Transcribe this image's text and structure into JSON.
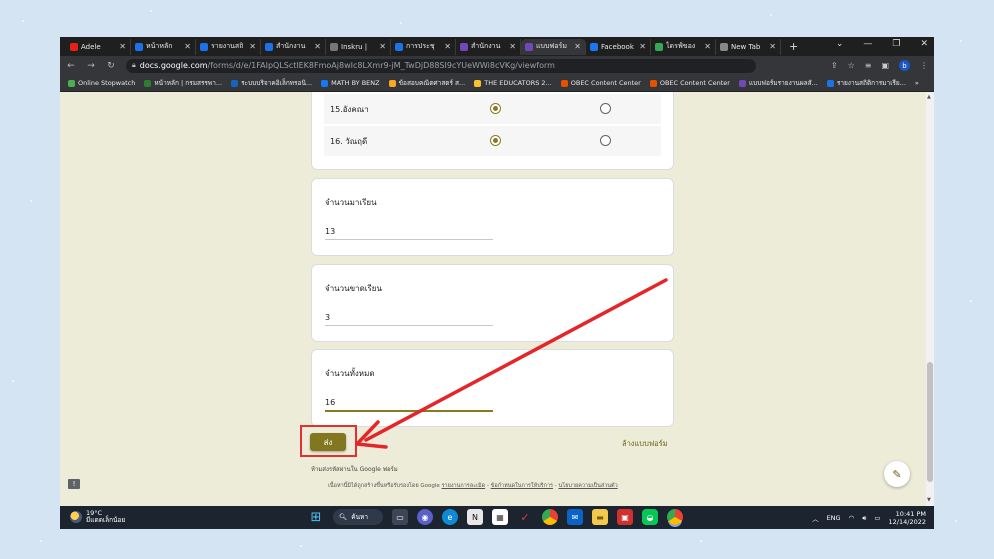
{
  "browser": {
    "tabs": [
      {
        "label": "Adele",
        "color": "#e62117"
      },
      {
        "label": "หน้าหลัก",
        "color": "#1a73e8"
      },
      {
        "label": "รายงานสถิ",
        "color": "#1a73e8"
      },
      {
        "label": "สำนักงาน",
        "color": "#1a73e8"
      },
      {
        "label": "Inskru |",
        "color": "#777777"
      },
      {
        "label": "การประชุ",
        "color": "#1a73e8"
      },
      {
        "label": "สำนักงาน",
        "color": "#7248b9"
      },
      {
        "label": "แบบฟอร์ม",
        "color": "#7248b9"
      },
      {
        "label": "Facebook",
        "color": "#1877f2"
      },
      {
        "label": "ไดรฟ์ของ",
        "color": "#34a853"
      },
      {
        "label": "New Tab",
        "color": "#888888"
      }
    ],
    "new_tab_symbol": "+",
    "url_domain": "docs.google.com",
    "url_path": "/forms/d/e/1FAIpQLSctlEK8FmoAj8wIc8LXmr9-jM_TwDjD88SI9cYUeWWi8cVKg/viewform",
    "profile_initial": "b",
    "bookmarks": [
      {
        "label": "Online Stopwatch",
        "color": "#4caf50"
      },
      {
        "label": "หน้าหลัก | กรมสรรพา...",
        "color": "#2e7d32"
      },
      {
        "label": "ระบบบริจาคอิเล็กทรอนิ...",
        "color": "#1565c0"
      },
      {
        "label": "MATH BY BENZ",
        "color": "#1877f2"
      },
      {
        "label": "ข้อสอบคณิตศาสตร์ ส...",
        "color": "#f9a825"
      },
      {
        "label": "THE EDUCATORS 2...",
        "color": "#fbc02d"
      },
      {
        "label": "OBEC Content Center",
        "color": "#e65100"
      },
      {
        "label": "OBEC Content Center",
        "color": "#e65100"
      },
      {
        "label": "แบบฟอร์มรายงานผลสั...",
        "color": "#7248b9"
      },
      {
        "label": "รายงานสถิติการมาเรีย...",
        "color": "#1a73e8"
      }
    ],
    "bookmarks_more": "»"
  },
  "form": {
    "choices": [
      {
        "label": "15.อังคณา",
        "first_selected": true
      },
      {
        "label": "16. วัณฤดี",
        "first_selected": true
      }
    ],
    "questions": [
      {
        "label": "จำนวนมาเรียน",
        "value": "13"
      },
      {
        "label": "จำนวนขาดเรียน",
        "value": "3"
      },
      {
        "label": "จำนวนทั้งหมด",
        "value": "16"
      }
    ],
    "submit_label": "ส่ง",
    "clear_label": "ล้างแบบฟอร์ม",
    "never_password": "ห้ามส่งรหัสผ่านใน Google ฟอร์ม",
    "footer_text": "เนื้อหานี้มิได้ถูกสร้างขึ้นหรือรับรองโดย Google",
    "footer_links": [
      "รายงานการละเมิด",
      "ข้อกำหนดในการให้บริการ",
      "นโยบายความเป็นส่วนตัว"
    ],
    "report_icon": "!",
    "edit_icon": "✎"
  },
  "taskbar": {
    "temperature": "19°C",
    "weather_text": "มีแดดเล็กน้อย",
    "search_label": "ค้นหา",
    "language": "ENG",
    "time": "10:41 PM",
    "date": "12/14/2022"
  },
  "colors": {
    "accent": "#837620",
    "highlight": "#e53030"
  }
}
